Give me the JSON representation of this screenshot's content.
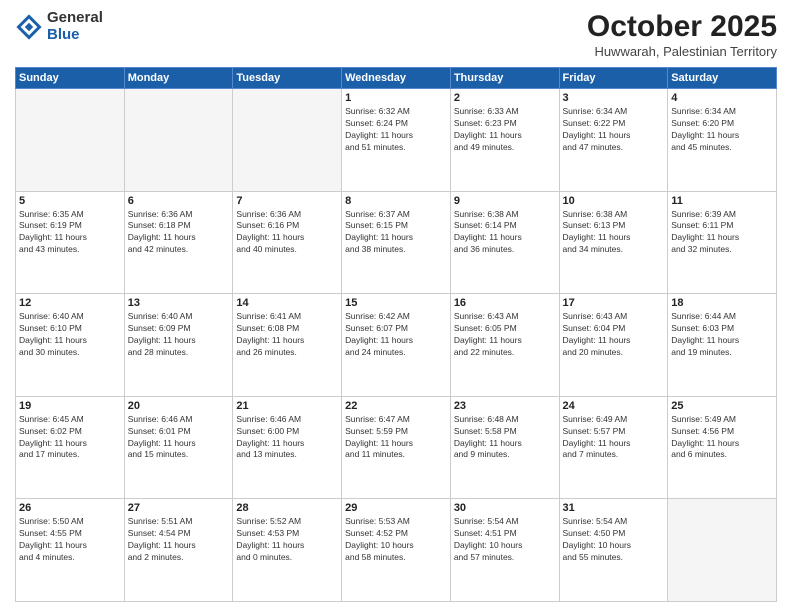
{
  "logo": {
    "general": "General",
    "blue": "Blue"
  },
  "header": {
    "month": "October 2025",
    "location": "Huwwarah, Palestinian Territory"
  },
  "weekdays": [
    "Sunday",
    "Monday",
    "Tuesday",
    "Wednesday",
    "Thursday",
    "Friday",
    "Saturday"
  ],
  "weeks": [
    [
      {
        "day": "",
        "info": ""
      },
      {
        "day": "",
        "info": ""
      },
      {
        "day": "",
        "info": ""
      },
      {
        "day": "1",
        "info": "Sunrise: 6:32 AM\nSunset: 6:24 PM\nDaylight: 11 hours\nand 51 minutes."
      },
      {
        "day": "2",
        "info": "Sunrise: 6:33 AM\nSunset: 6:23 PM\nDaylight: 11 hours\nand 49 minutes."
      },
      {
        "day": "3",
        "info": "Sunrise: 6:34 AM\nSunset: 6:22 PM\nDaylight: 11 hours\nand 47 minutes."
      },
      {
        "day": "4",
        "info": "Sunrise: 6:34 AM\nSunset: 6:20 PM\nDaylight: 11 hours\nand 45 minutes."
      }
    ],
    [
      {
        "day": "5",
        "info": "Sunrise: 6:35 AM\nSunset: 6:19 PM\nDaylight: 11 hours\nand 43 minutes."
      },
      {
        "day": "6",
        "info": "Sunrise: 6:36 AM\nSunset: 6:18 PM\nDaylight: 11 hours\nand 42 minutes."
      },
      {
        "day": "7",
        "info": "Sunrise: 6:36 AM\nSunset: 6:16 PM\nDaylight: 11 hours\nand 40 minutes."
      },
      {
        "day": "8",
        "info": "Sunrise: 6:37 AM\nSunset: 6:15 PM\nDaylight: 11 hours\nand 38 minutes."
      },
      {
        "day": "9",
        "info": "Sunrise: 6:38 AM\nSunset: 6:14 PM\nDaylight: 11 hours\nand 36 minutes."
      },
      {
        "day": "10",
        "info": "Sunrise: 6:38 AM\nSunset: 6:13 PM\nDaylight: 11 hours\nand 34 minutes."
      },
      {
        "day": "11",
        "info": "Sunrise: 6:39 AM\nSunset: 6:11 PM\nDaylight: 11 hours\nand 32 minutes."
      }
    ],
    [
      {
        "day": "12",
        "info": "Sunrise: 6:40 AM\nSunset: 6:10 PM\nDaylight: 11 hours\nand 30 minutes."
      },
      {
        "day": "13",
        "info": "Sunrise: 6:40 AM\nSunset: 6:09 PM\nDaylight: 11 hours\nand 28 minutes."
      },
      {
        "day": "14",
        "info": "Sunrise: 6:41 AM\nSunset: 6:08 PM\nDaylight: 11 hours\nand 26 minutes."
      },
      {
        "day": "15",
        "info": "Sunrise: 6:42 AM\nSunset: 6:07 PM\nDaylight: 11 hours\nand 24 minutes."
      },
      {
        "day": "16",
        "info": "Sunrise: 6:43 AM\nSunset: 6:05 PM\nDaylight: 11 hours\nand 22 minutes."
      },
      {
        "day": "17",
        "info": "Sunrise: 6:43 AM\nSunset: 6:04 PM\nDaylight: 11 hours\nand 20 minutes."
      },
      {
        "day": "18",
        "info": "Sunrise: 6:44 AM\nSunset: 6:03 PM\nDaylight: 11 hours\nand 19 minutes."
      }
    ],
    [
      {
        "day": "19",
        "info": "Sunrise: 6:45 AM\nSunset: 6:02 PM\nDaylight: 11 hours\nand 17 minutes."
      },
      {
        "day": "20",
        "info": "Sunrise: 6:46 AM\nSunset: 6:01 PM\nDaylight: 11 hours\nand 15 minutes."
      },
      {
        "day": "21",
        "info": "Sunrise: 6:46 AM\nSunset: 6:00 PM\nDaylight: 11 hours\nand 13 minutes."
      },
      {
        "day": "22",
        "info": "Sunrise: 6:47 AM\nSunset: 5:59 PM\nDaylight: 11 hours\nand 11 minutes."
      },
      {
        "day": "23",
        "info": "Sunrise: 6:48 AM\nSunset: 5:58 PM\nDaylight: 11 hours\nand 9 minutes."
      },
      {
        "day": "24",
        "info": "Sunrise: 6:49 AM\nSunset: 5:57 PM\nDaylight: 11 hours\nand 7 minutes."
      },
      {
        "day": "25",
        "info": "Sunrise: 5:49 AM\nSunset: 4:56 PM\nDaylight: 11 hours\nand 6 minutes."
      }
    ],
    [
      {
        "day": "26",
        "info": "Sunrise: 5:50 AM\nSunset: 4:55 PM\nDaylight: 11 hours\nand 4 minutes."
      },
      {
        "day": "27",
        "info": "Sunrise: 5:51 AM\nSunset: 4:54 PM\nDaylight: 11 hours\nand 2 minutes."
      },
      {
        "day": "28",
        "info": "Sunrise: 5:52 AM\nSunset: 4:53 PM\nDaylight: 11 hours\nand 0 minutes."
      },
      {
        "day": "29",
        "info": "Sunrise: 5:53 AM\nSunset: 4:52 PM\nDaylight: 10 hours\nand 58 minutes."
      },
      {
        "day": "30",
        "info": "Sunrise: 5:54 AM\nSunset: 4:51 PM\nDaylight: 10 hours\nand 57 minutes."
      },
      {
        "day": "31",
        "info": "Sunrise: 5:54 AM\nSunset: 4:50 PM\nDaylight: 10 hours\nand 55 minutes."
      },
      {
        "day": "",
        "info": ""
      }
    ]
  ]
}
